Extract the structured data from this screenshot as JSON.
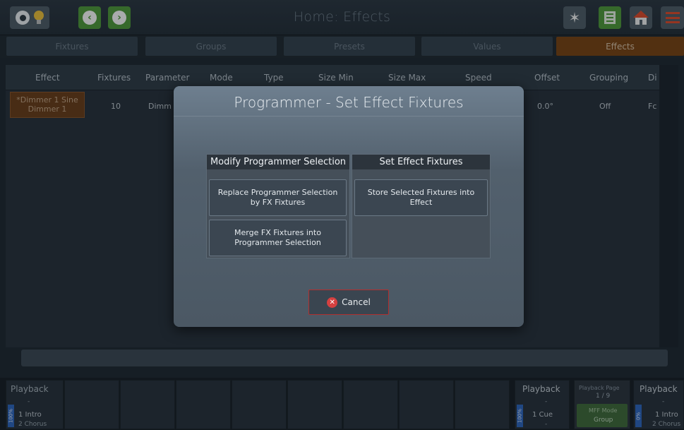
{
  "title": "Home: Effects",
  "tabs": [
    "Fixtures",
    "Groups",
    "Presets",
    "Values",
    "Effects"
  ],
  "table": {
    "headers": [
      "Effect",
      "Fixtures",
      "Parameter",
      "Mode",
      "Type",
      "Size Min",
      "Size Max",
      "Speed",
      "Offset",
      "Grouping",
      "Di"
    ],
    "row": {
      "effect_line1": "*Dimmer 1 Sine",
      "effect_line2": "Dimmer 1",
      "fixtures": "10",
      "parameter": "Dimm",
      "offset": "0.0°",
      "grouping": "Off",
      "di": "Fc"
    }
  },
  "dialog": {
    "title": "Programmer - Set Effect Fixtures",
    "left_panel": {
      "header": "Modify Programmer Selection",
      "buttons": [
        "Replace Programmer Selection by FX Fixtures",
        "Merge FX Fixtures into Programmer Selection"
      ]
    },
    "right_panel": {
      "header": "Set Effect Fixtures",
      "buttons": [
        "Store Selected Fixtures into Effect"
      ]
    },
    "cancel_label": "Cancel"
  },
  "playbacks": {
    "left": {
      "title": "Playback",
      "level": "100%",
      "dash": "-",
      "line1": "1 Intro",
      "line2": "2 Chorus"
    },
    "right1": {
      "title": "Playback",
      "level": "100%",
      "dash": "-",
      "line1": "1 Cue",
      "line2": "-"
    },
    "page": {
      "title": "Playback Page",
      "value": "1 / 9",
      "mode_label": "MFF Mode",
      "mode_value": "Group"
    },
    "right2": {
      "title": "Playback",
      "level": "0%",
      "dash": "-",
      "line1": "1 Intro",
      "line2": "2 Chorus"
    }
  },
  "colors": {
    "accent": "#7a4311",
    "cancel_border": "#b12f2f",
    "level_blue": "#2d66c0",
    "mff_green": "#3f6a3a"
  }
}
